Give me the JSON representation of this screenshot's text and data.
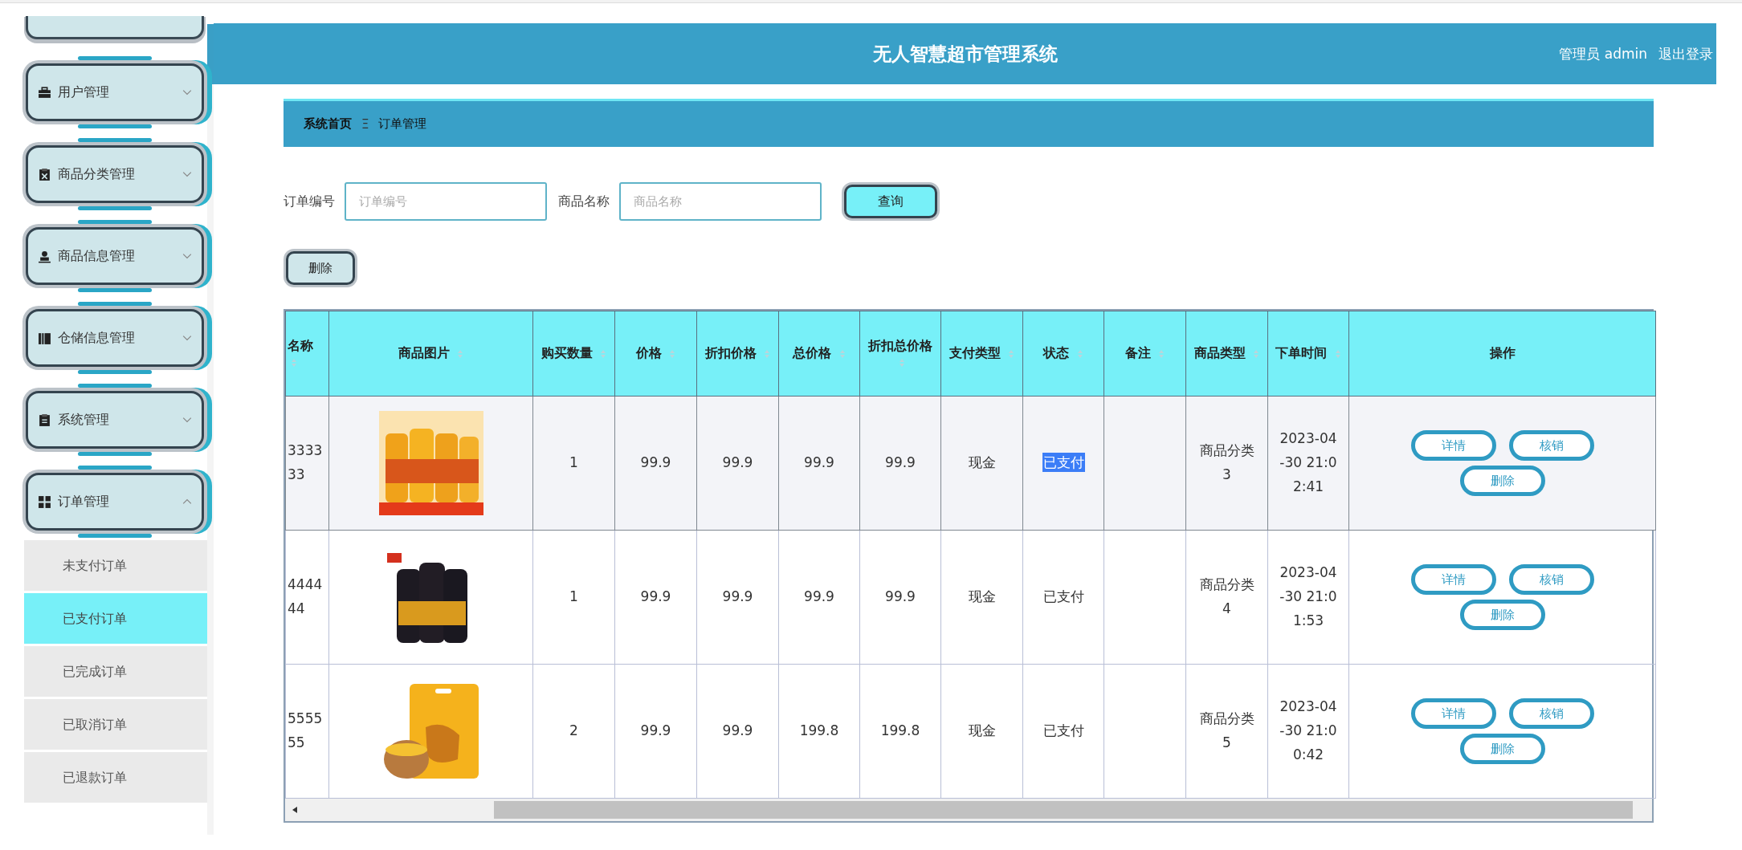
{
  "header": {
    "title": "无人智慧超市管理系统",
    "user": "管理员 admin",
    "logout": "退出登录"
  },
  "sidebar": {
    "items": [
      {
        "label": "用户管理",
        "expanded": false
      },
      {
        "label": "商品分类管理",
        "expanded": false
      },
      {
        "label": "商品信息管理",
        "expanded": false
      },
      {
        "label": "仓储信息管理",
        "expanded": false
      },
      {
        "label": "系统管理",
        "expanded": false
      },
      {
        "label": "订单管理",
        "expanded": true,
        "children": [
          {
            "label": "未支付订单",
            "selected": false
          },
          {
            "label": "已支付订单",
            "selected": true
          },
          {
            "label": "已完成订单",
            "selected": false
          },
          {
            "label": "已取消订单",
            "selected": false
          },
          {
            "label": "已退款订单",
            "selected": false
          }
        ]
      }
    ]
  },
  "breadcrumb": {
    "home": "系统首页",
    "separator": "Ξ",
    "current": "订单管理"
  },
  "search": {
    "fields": [
      {
        "label": "订单编号",
        "placeholder": "订单编号"
      },
      {
        "label": "商品名称",
        "placeholder": "商品名称"
      }
    ],
    "button": "查询"
  },
  "delete_button": "删除",
  "table": {
    "columns": [
      {
        "label": "名称",
        "sortable": true
      },
      {
        "label": "商品图片",
        "sortable": true
      },
      {
        "label": "购买数量",
        "sortable": true
      },
      {
        "label": "价格",
        "sortable": true
      },
      {
        "label": "折扣价格",
        "sortable": true
      },
      {
        "label": "总价格",
        "sortable": true
      },
      {
        "label": "折扣总价格",
        "sortable": true
      },
      {
        "label": "支付类型",
        "sortable": true
      },
      {
        "label": "状态",
        "sortable": true
      },
      {
        "label": "备注",
        "sortable": true
      },
      {
        "label": "商品类型",
        "sortable": true
      },
      {
        "label": "下单时间",
        "sortable": true
      },
      {
        "label": "操作",
        "sortable": false
      }
    ],
    "rows": [
      {
        "name": "333333",
        "quantity": "1",
        "price": "99.9",
        "discount_price": "99.9",
        "total": "99.9",
        "discount_total": "99.9",
        "payment": "现金",
        "status": "已支付",
        "status_highlighted": true,
        "category": "商品分类3",
        "time": "2023-04-30 21:02:41",
        "actions": [
          "详情",
          "核销",
          "删除"
        ]
      },
      {
        "name": "444444",
        "quantity": "1",
        "price": "99.9",
        "discount_price": "99.9",
        "total": "99.9",
        "discount_total": "99.9",
        "payment": "现金",
        "status": "已支付",
        "status_highlighted": false,
        "category": "商品分类4",
        "time": "2023-04-30 21:01:53",
        "actions": [
          "详情",
          "核销",
          "删除"
        ]
      },
      {
        "name": "555555",
        "quantity": "2",
        "price": "99.9",
        "discount_price": "99.9",
        "total": "199.8",
        "discount_total": "199.8",
        "payment": "现金",
        "status": "已支付",
        "status_highlighted": false,
        "category": "商品分类5",
        "time": "2023-04-30 21:00:42",
        "actions": [
          "详情",
          "核销",
          "删除"
        ]
      }
    ]
  }
}
